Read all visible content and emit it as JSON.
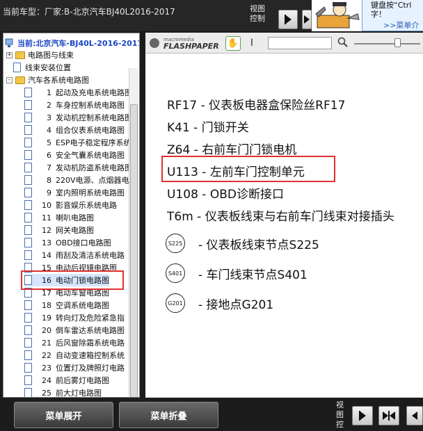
{
  "header": {
    "vehicle_title": "当前车型：厂家:B-北京汽车BJ40L2016-2017",
    "view_control_label": "视图控制"
  },
  "tip": {
    "text_line1": "键盘按“Ctrl",
    "text_line2": "字！",
    "link": ">>菜单介"
  },
  "tree": {
    "current": "当前:北京汽车-BJ40L-2016-2017",
    "nodes": [
      {
        "label": "电路图与线束",
        "kind": "folder",
        "expander": "+"
      },
      {
        "label": "线束安装位置",
        "kind": "doc"
      },
      {
        "label": "汽车各系统电路图",
        "kind": "folder",
        "expander": "-"
      }
    ],
    "items": [
      {
        "num": "1",
        "label": "起动及充电系统电路图"
      },
      {
        "num": "2",
        "label": "车身控制系统电路图"
      },
      {
        "num": "3",
        "label": "发动机控制系统电路图"
      },
      {
        "num": "4",
        "label": "组合仪表系统电路图"
      },
      {
        "num": "5",
        "label": "ESP电子稳定程序系统"
      },
      {
        "num": "6",
        "label": "安全气囊系统电路图"
      },
      {
        "num": "7",
        "label": "发动机防盗系统电路图"
      },
      {
        "num": "8",
        "label": "220V电源、点烟器电"
      },
      {
        "num": "9",
        "label": "室内照明系统电路图"
      },
      {
        "num": "10",
        "label": "影音娱乐系统电路"
      },
      {
        "num": "11",
        "label": "喇叭电路图"
      },
      {
        "num": "12",
        "label": "网关电路图"
      },
      {
        "num": "13",
        "label": "OBD接口电路图"
      },
      {
        "num": "14",
        "label": "雨刮及清洁系统电路"
      },
      {
        "num": "15",
        "label": "电动后视镜电路图"
      },
      {
        "num": "16",
        "label": "电动门锁电路图"
      },
      {
        "num": "17",
        "label": "电动车窗电路图"
      },
      {
        "num": "18",
        "label": "空调系统电路图"
      },
      {
        "num": "19",
        "label": "转向灯及危险紧急指"
      },
      {
        "num": "20",
        "label": "倒车雷达系统电路图"
      },
      {
        "num": "21",
        "label": "后风窗除霜系统电路"
      },
      {
        "num": "22",
        "label": "自动变速箱控制系统"
      },
      {
        "num": "23",
        "label": "位置灯及牌照灯电路"
      },
      {
        "num": "24",
        "label": "前后雾灯电路图"
      },
      {
        "num": "25",
        "label": "前大灯电路图"
      }
    ]
  },
  "flashpaper": {
    "logo_top": "macromedia",
    "logo_main": "FLASHPAPER",
    "search_value": ""
  },
  "legend": {
    "rows": [
      "RF17 - 仪表板电器盒保险丝RF17",
      "K41 - 门锁开关",
      "Z64 - 右前车门门锁电机",
      "U113 - 左前车门控制单元",
      "U108 - OBD诊断接口",
      "T6m - 仪表板线束与右前车门线束对接插头"
    ],
    "nodes": [
      {
        "code": "S225",
        "desc": "-  仪表板线束节点S225"
      },
      {
        "code": "S401",
        "desc": "-  车门线束节点S401"
      },
      {
        "code": "G201",
        "desc": "-  接地点G201"
      }
    ]
  },
  "bottom": {
    "expand_label": "菜单展开",
    "collapse_label": "菜单折叠",
    "view_control_label": "视图控"
  }
}
